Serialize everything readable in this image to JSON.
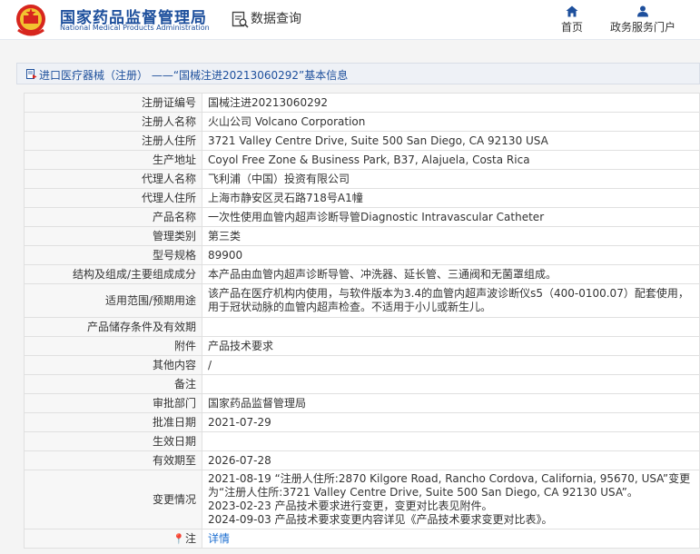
{
  "header": {
    "org_name_cn": "国家药品监督管理局",
    "org_name_en": "National Medical Products Administration",
    "query_title": "数据查询",
    "nav": {
      "home_label": "首页",
      "service_label": "政务服务门户"
    }
  },
  "breadcrumb": {
    "text": "进口医疗器械（注册） ——“国械注进20213060292”基本信息"
  },
  "record": {
    "rows": [
      {
        "label": "注册证编号",
        "value": "国械注进20213060292"
      },
      {
        "label": "注册人名称",
        "value": "火山公司 Volcano Corporation"
      },
      {
        "label": "注册人住所",
        "value": "3721 Valley Centre Drive, Suite 500 San Diego, CA 92130 USA"
      },
      {
        "label": "生产地址",
        "value": "Coyol Free Zone & Business Park, B37, Alajuela, Costa Rica"
      },
      {
        "label": "代理人名称",
        "value": "飞利浦（中国）投资有限公司"
      },
      {
        "label": "代理人住所",
        "value": "上海市静安区灵石路718号A1幢"
      },
      {
        "label": "产品名称",
        "value": "一次性使用血管内超声诊断导管Diagnostic Intravascular Catheter"
      },
      {
        "label": "管理类别",
        "value": "第三类"
      },
      {
        "label": "型号规格",
        "value": "89900"
      },
      {
        "label": "结构及组成/主要组成成分",
        "value": "本产品由血管内超声诊断导管、冲洗器、延长管、三通阀和无菌罩组成。"
      },
      {
        "label": "适用范围/预期用途",
        "value": "该产品在医疗机构内使用，与软件版本为3.4的血管内超声波诊断仪s5（400-0100.07）配套使用，用于冠状动脉的血管内超声检查。不适用于小儿或新生儿。"
      },
      {
        "label": "产品储存条件及有效期",
        "value": ""
      },
      {
        "label": "附件",
        "value": "产品技术要求"
      },
      {
        "label": "其他内容",
        "value": "/"
      },
      {
        "label": "备注",
        "value": ""
      },
      {
        "label": "审批部门",
        "value": "国家药品监督管理局"
      },
      {
        "label": "批准日期",
        "value": "2021-07-29"
      },
      {
        "label": "生效日期",
        "value": ""
      },
      {
        "label": "有效期至",
        "value": "2026-07-28"
      }
    ],
    "changes": {
      "label": "变更情况",
      "lines": [
        "2021-08-19 “注册人住所:2870 Kilgore Road, Rancho Cordova, California, 95670, USA”变更为“注册人住所:3721 Valley Centre Drive, Suite 500 San Diego, CA 92130 USA”。",
        "2023-02-23 产品技术要求进行变更，变更对比表见附件。",
        "2024-09-03 产品技术要求变更内容详见《产品技术要求变更对比表》。"
      ]
    },
    "note": {
      "label": "注",
      "link_text": "详情"
    }
  },
  "colors": {
    "brand_blue": "#1d4f9c",
    "logo_red": "#d7261e",
    "link_blue": "#1d6fd1"
  }
}
